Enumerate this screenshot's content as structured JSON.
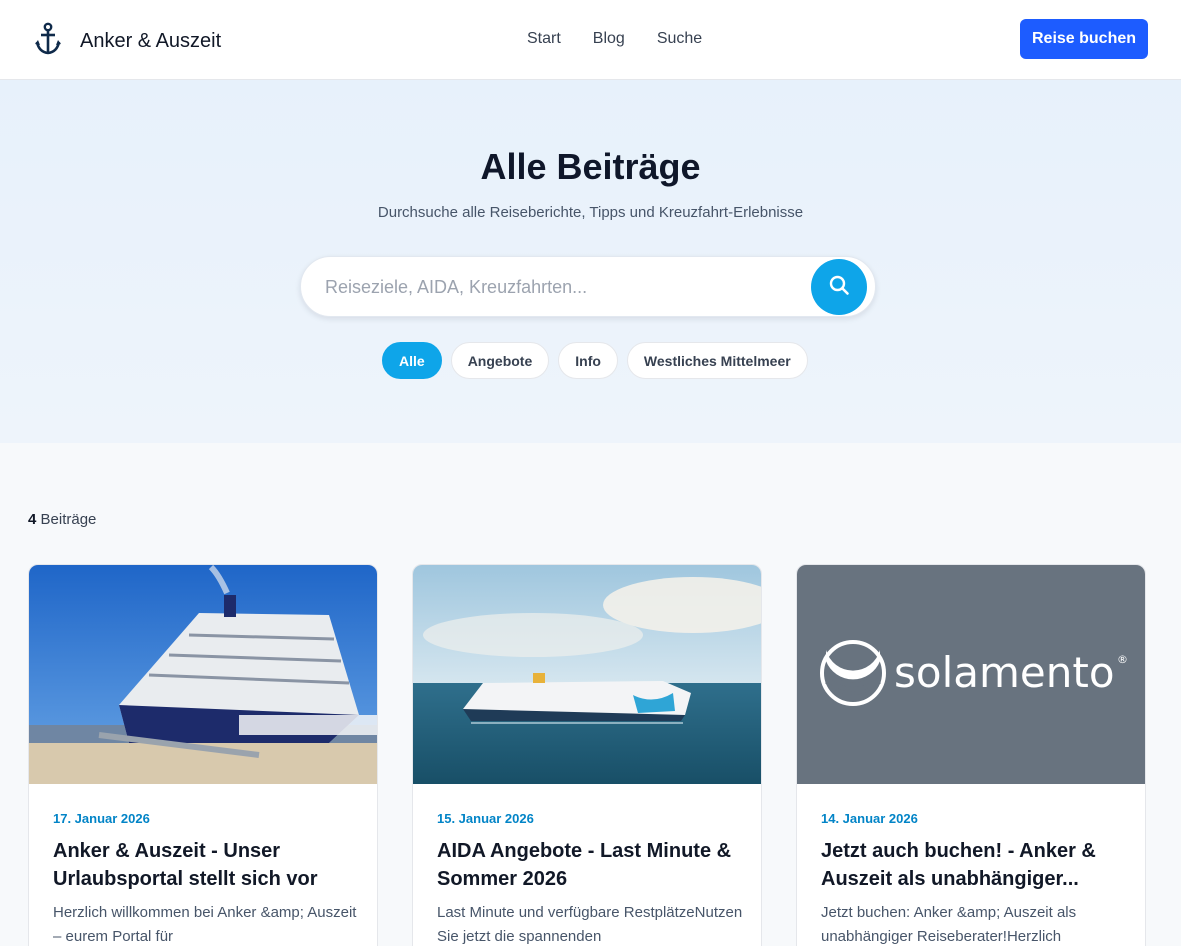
{
  "brand": {
    "name": "Anker & Auszeit",
    "icon": "anchor-icon"
  },
  "nav": {
    "items": [
      "Start",
      "Blog",
      "Suche"
    ]
  },
  "cta": {
    "label": "Reise buchen"
  },
  "hero": {
    "title": "Alle Beiträge",
    "subtitle": "Durchsuche alle Reiseberichte, Tipps und Kreuzfahrt-Erlebnisse",
    "search_placeholder": "Reiseziele, AIDA, Kreuzfahrten...",
    "search_value": ""
  },
  "filters": [
    {
      "label": "Alle",
      "active": true
    },
    {
      "label": "Angebote",
      "active": false
    },
    {
      "label": "Info",
      "active": false
    },
    {
      "label": "Westliches Mittelmeer",
      "active": false
    }
  ],
  "results": {
    "count": "4",
    "label": " Beiträge"
  },
  "posts": [
    {
      "date": "17. Januar 2026",
      "title": "Anker & Auszeit - Unser Urlaubsportal stellt sich vor",
      "excerpt": "Herzlich willkommen bei Anker &amp; Auszeit – eurem Portal für",
      "image": "cruise-ship-at-pier-photo"
    },
    {
      "date": "15. Januar 2026",
      "title": "AIDA Angebote - Last Minute & Sommer 2026",
      "excerpt": "Last Minute und verfügbare RestplätzeNutzen Sie jetzt die spannenden",
      "image": "aida-ship-at-sea-photo"
    },
    {
      "date": "14. Januar 2026",
      "title": "Jetzt auch buchen! - Anker & Auszeit als unabhängiger...",
      "excerpt": "Jetzt buchen: Anker &amp; Auszeit als unabhängiger Reiseberater!Herzlich",
      "image": "solamento-logo",
      "logo_text": "solamento"
    }
  ],
  "colors": {
    "accent": "#0ea5e9",
    "cta": "#1d5cff",
    "date": "#0284c7",
    "logo_bg": "#68737f"
  }
}
